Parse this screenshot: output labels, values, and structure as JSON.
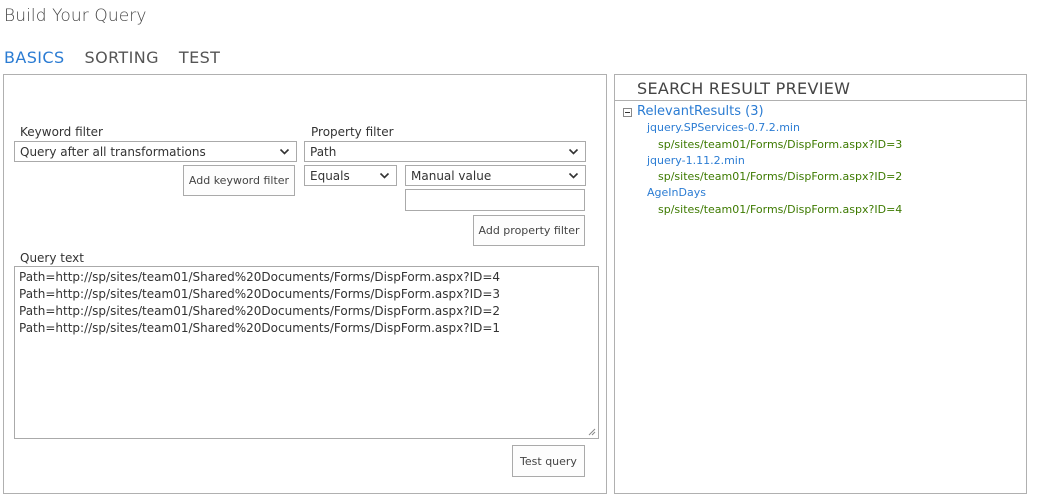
{
  "page": {
    "title": "Build Your Query"
  },
  "tabs": [
    {
      "label": "BASICS"
    },
    {
      "label": "SORTING"
    },
    {
      "label": "TEST"
    }
  ],
  "keyword_filter": {
    "label": "Keyword filter",
    "selected": "Query after all transformations",
    "add_button": "Add keyword filter"
  },
  "property_filter": {
    "label": "Property filter",
    "property_selected": "Path",
    "operator_selected": "Equals",
    "value_mode_selected": "Manual value",
    "value_input": "",
    "add_button": "Add property filter"
  },
  "query_text": {
    "label": "Query text",
    "lines": [
      "Path=http://sp/sites/team01/Shared%20Documents/Forms/DispForm.aspx?ID=4",
      "Path=http://sp/sites/team01/Shared%20Documents/Forms/DispForm.aspx?ID=3",
      "Path=http://sp/sites/team01/Shared%20Documents/Forms/DispForm.aspx?ID=2",
      "Path=http://sp/sites/team01/Shared%20Documents/Forms/DispForm.aspx?ID=1"
    ]
  },
  "test_button": "Test query",
  "preview": {
    "header": "SEARCH RESULT PREVIEW",
    "root": "RelevantResults (3)",
    "results": [
      {
        "title": "jquery.SPServices-0.7.2.min",
        "path": "sp/sites/team01/Forms/DispForm.aspx?ID=3"
      },
      {
        "title": "jquery-1.11.2.min",
        "path": "sp/sites/team01/Forms/DispForm.aspx?ID=2"
      },
      {
        "title": "AgeInDays",
        "path": "sp/sites/team01/Forms/DispForm.aspx?ID=4"
      }
    ]
  },
  "colors": {
    "accent": "#2b7cd3",
    "path_green": "#3d7a00",
    "border": "#b0b0b0"
  },
  "icons": {
    "dropdown": "chevron-down-icon",
    "tree_toggle": "collapse-icon",
    "resize": "resize-grip-icon"
  }
}
